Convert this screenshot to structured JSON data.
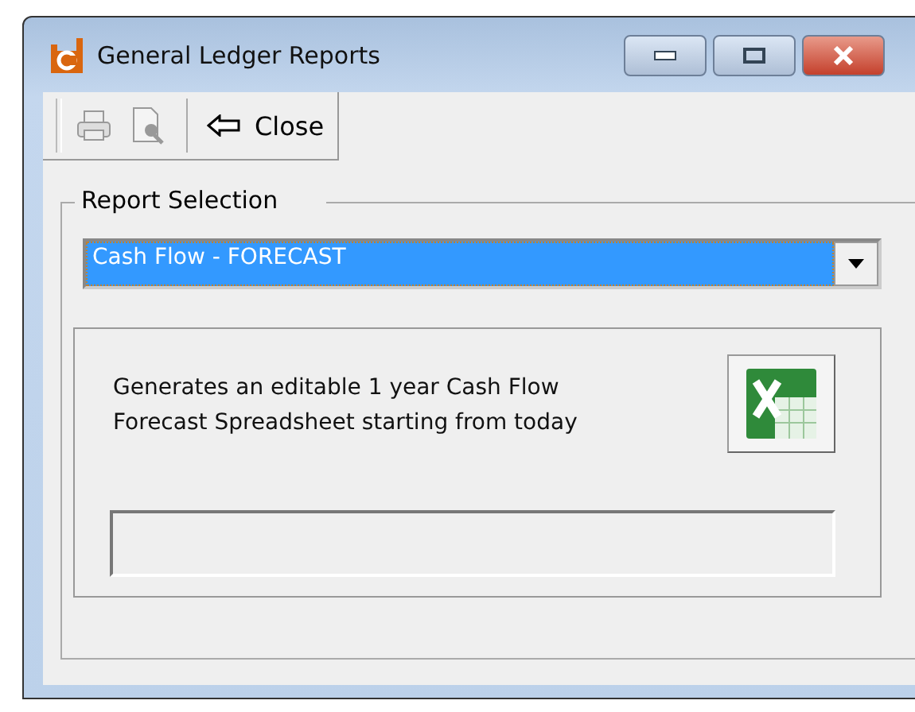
{
  "window": {
    "title": "General Ledger Reports"
  },
  "toolbar": [
    {
      "kind": "print",
      "disabled": true
    },
    {
      "kind": "preview",
      "disabled": true
    },
    {
      "kind": "close",
      "label": "Close",
      "disabled": false
    }
  ],
  "report_selection": {
    "label": "Report Selection",
    "value": "Cash Flow - FORECAST",
    "description_lines": [
      "Generates an editable 1 year Cash Flow",
      "Forecast Spreadsheet starting from today"
    ]
  }
}
